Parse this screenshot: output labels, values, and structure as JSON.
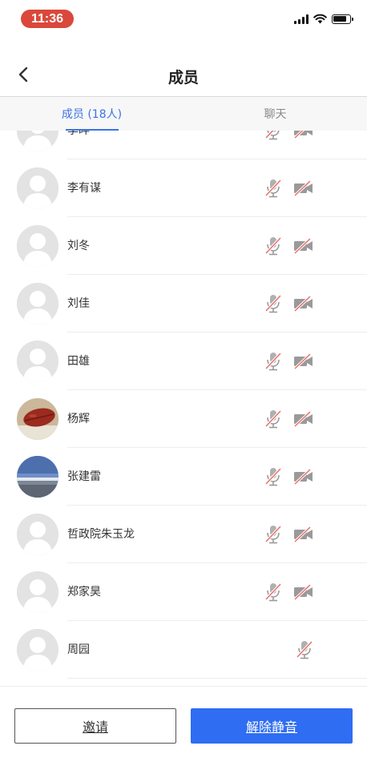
{
  "status_bar": {
    "time": "11:36"
  },
  "header": {
    "title": "成员"
  },
  "tabs": [
    {
      "label": "成员 (18人)",
      "active": true
    },
    {
      "label": "聊天",
      "active": false
    }
  ],
  "members": [
    {
      "name": "李晔",
      "avatar": "default",
      "mic_muted": true,
      "camera_off": true
    },
    {
      "name": "李有谋",
      "avatar": "default",
      "mic_muted": true,
      "camera_off": true
    },
    {
      "name": "刘冬",
      "avatar": "default",
      "mic_muted": true,
      "camera_off": true
    },
    {
      "name": "刘佳",
      "avatar": "default",
      "mic_muted": true,
      "camera_off": true
    },
    {
      "name": "田雄",
      "avatar": "default",
      "mic_muted": true,
      "camera_off": true
    },
    {
      "name": "杨辉",
      "avatar": "photo-leaf",
      "mic_muted": true,
      "camera_off": true
    },
    {
      "name": "张建雷",
      "avatar": "photo-landscape",
      "mic_muted": true,
      "camera_off": true
    },
    {
      "name": "哲政院朱玉龙",
      "avatar": "default",
      "mic_muted": true,
      "camera_off": true
    },
    {
      "name": "郑家昊",
      "avatar": "default",
      "mic_muted": true,
      "camera_off": true
    },
    {
      "name": "周园",
      "avatar": "default",
      "mic_muted": true,
      "camera_off": null
    }
  ],
  "footer": {
    "invite_label": "邀请",
    "unmute_label": "解除静音"
  },
  "colors": {
    "accent": "#3a73e8",
    "primary_button": "#2f6df2",
    "muted_slash": "#e8716a",
    "time_pill": "#d9483b"
  }
}
